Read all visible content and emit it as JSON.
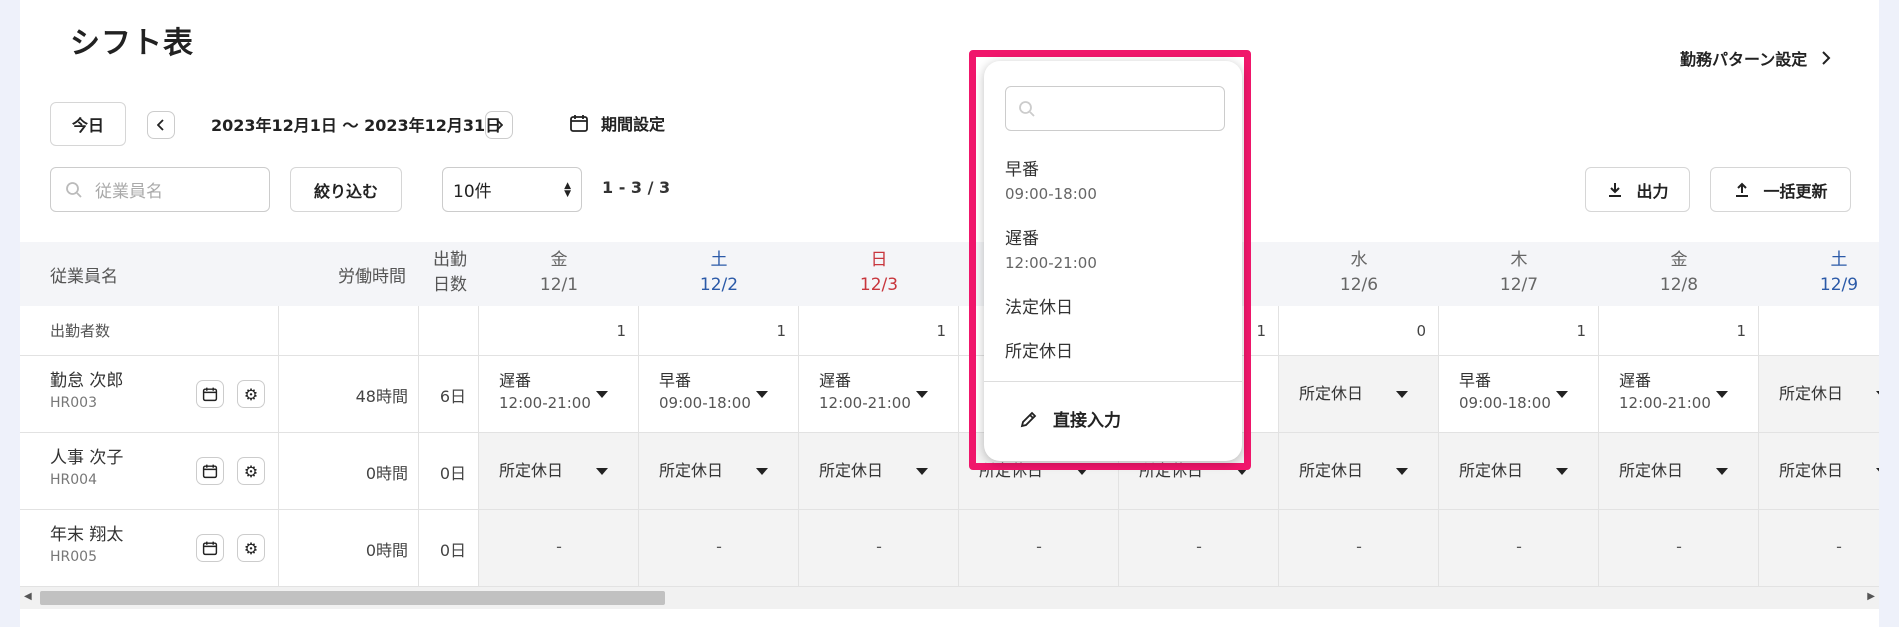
{
  "page": {
    "title": "シフト表",
    "pattern_settings": "勤務パターン設定"
  },
  "toolbar": {
    "today": "今日",
    "range": "2023年12月1日 〜 2023年12月31日",
    "period": "期間設定",
    "search_placeholder": "従業員名",
    "filter": "絞り込む",
    "per_page": "10件",
    "count": "1 - 3 / 3",
    "export": "出力",
    "bulk_update": "一括更新"
  },
  "table": {
    "headers": {
      "employee": "従業員名",
      "hours": "労働時間",
      "days_line1": "出勤",
      "days_line2": "日数"
    },
    "days": [
      {
        "dow": "金",
        "date": "12/1",
        "color": "normal"
      },
      {
        "dow": "土",
        "date": "12/2",
        "color": "blue"
      },
      {
        "dow": "日",
        "date": "12/3",
        "color": "red"
      },
      {
        "dow": "",
        "date": "",
        "color": "normal"
      },
      {
        "dow": "",
        "date": "",
        "color": "normal"
      },
      {
        "dow": "水",
        "date": "12/6",
        "color": "normal"
      },
      {
        "dow": "木",
        "date": "12/7",
        "color": "normal"
      },
      {
        "dow": "金",
        "date": "12/8",
        "color": "normal"
      },
      {
        "dow": "土",
        "date": "12/9",
        "color": "blue"
      }
    ],
    "attendance_label": "出勤者数",
    "attendance_counts": [
      "1",
      "1",
      "1",
      "",
      "1",
      "0",
      "1",
      "1",
      ""
    ],
    "rows": [
      {
        "name": "勤怠 次郎",
        "id": "HR003",
        "hours": "48時間",
        "days": "6日",
        "shifts": [
          {
            "label": "遅番",
            "time": "12:00-21:00"
          },
          {
            "label": "早番",
            "time": "09:00-18:00"
          },
          {
            "label": "遅番",
            "time": "12:00-21:00"
          },
          {
            "label": "",
            "time": ""
          },
          {
            "label": "",
            "time": ""
          },
          {
            "label": "所定休日",
            "time": ""
          },
          {
            "label": "早番",
            "time": "09:00-18:00"
          },
          {
            "label": "遅番",
            "time": "12:00-21:00"
          },
          {
            "label": "所定休日",
            "time": ""
          }
        ]
      },
      {
        "name": "人事 次子",
        "id": "HR004",
        "hours": "0時間",
        "days": "0日",
        "shifts": [
          {
            "label": "所定休日",
            "time": ""
          },
          {
            "label": "所定休日",
            "time": ""
          },
          {
            "label": "所定休日",
            "time": ""
          },
          {
            "label": "所定休日",
            "time": ""
          },
          {
            "label": "所定休日",
            "time": ""
          },
          {
            "label": "所定休日",
            "time": ""
          },
          {
            "label": "所定休日",
            "time": ""
          },
          {
            "label": "所定休日",
            "time": ""
          },
          {
            "label": "所定休日",
            "time": ""
          }
        ]
      },
      {
        "name": "年末 翔太",
        "id": "HR005",
        "hours": "0時間",
        "days": "0日",
        "shifts": [
          {
            "label": "-",
            "time": ""
          },
          {
            "label": "-",
            "time": ""
          },
          {
            "label": "-",
            "time": ""
          },
          {
            "label": "-",
            "time": ""
          },
          {
            "label": "-",
            "time": ""
          },
          {
            "label": "-",
            "time": ""
          },
          {
            "label": "-",
            "time": ""
          },
          {
            "label": "-",
            "time": ""
          },
          {
            "label": "-",
            "time": ""
          }
        ]
      }
    ]
  },
  "popup": {
    "search_placeholder": "",
    "options": [
      {
        "label": "早番",
        "time": "09:00-18:00"
      },
      {
        "label": "遅番",
        "time": "12:00-21:00"
      },
      {
        "label": "法定休日",
        "time": ""
      },
      {
        "label": "所定休日",
        "time": ""
      }
    ],
    "direct_input": "直接入力"
  },
  "colors": {
    "highlight": "#f0166b",
    "blue": "#2b5aa8",
    "red": "#c8363d"
  }
}
